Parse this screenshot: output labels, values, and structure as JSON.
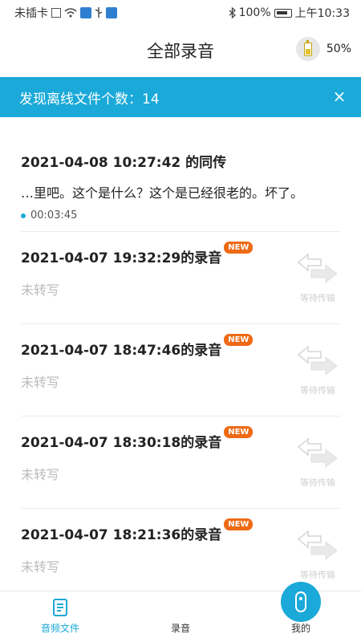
{
  "status_bar": {
    "carrier": "未插卡",
    "battery": "100%",
    "time": "上午10:33"
  },
  "header": {
    "title": "全部录音",
    "device_battery": "50%"
  },
  "banner": {
    "text": "发现离线文件个数：14",
    "close_icon": "×"
  },
  "recordings": [
    {
      "title": "2021-04-08 10:27:42 的同传",
      "text": "…里吧。这个是什么？这个是已经很老的。坏了。",
      "duration": "00:03:45"
    },
    {
      "title": "2021-04-07 19:32:29的录音",
      "badge": "NEW",
      "status": "未转写",
      "transfer_label": "等待传输"
    },
    {
      "title": "2021-04-07 18:47:46的录音",
      "badge": "NEW",
      "status": "未转写",
      "transfer_label": "等待传输"
    },
    {
      "title": "2021-04-07 18:30:18的录音",
      "badge": "NEW",
      "status": "未转写",
      "transfer_label": "等待传输"
    },
    {
      "title": "2021-04-07 18:21:36的录音",
      "badge": "NEW",
      "status": "未转写",
      "transfer_label": "等待传输"
    }
  ],
  "bottom_nav": {
    "files": "音频文件",
    "record": "录音",
    "mine": "我的"
  },
  "colors": {
    "accent": "#1aa9d8",
    "badge": "#ee6a15"
  }
}
